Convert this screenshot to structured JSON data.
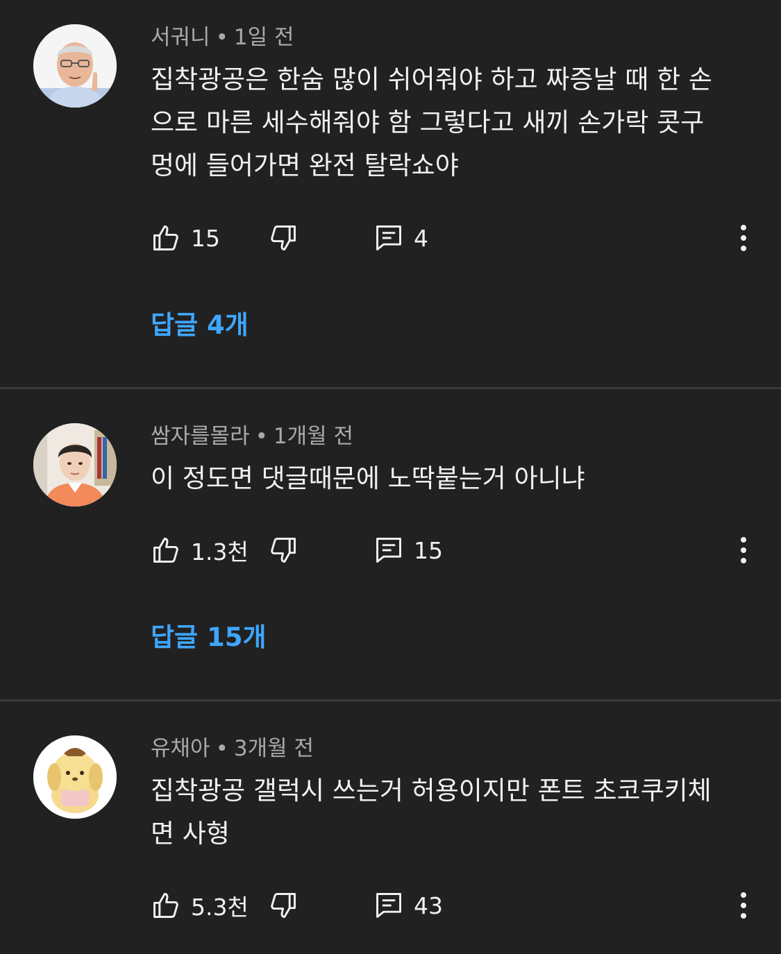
{
  "comments": [
    {
      "author": "서궈니",
      "time": "1일 전",
      "separator": "•",
      "lines": [
        "집착광공은 한숨 많이 쉬어줘야 하고 짜증날 때 한 손",
        "으로 마른 세수해줘야 함 그렇다고 새끼 손가락 콧구",
        "멍에 들어가면 완전 탈락쇼야"
      ],
      "likes": "15",
      "reply_count": "4",
      "replies_label": "답글 4개"
    },
    {
      "author": "쌈자를몰라",
      "time": "1개월 전",
      "separator": "•",
      "lines": [
        "이 정도면 댓글때문에 노딱붙는거 아니냐"
      ],
      "likes": "1.3천",
      "reply_count": "15",
      "replies_label": "답글 15개"
    },
    {
      "author": "유채아",
      "time": "3개월 전",
      "separator": "•",
      "lines": [
        "집착광공 갤럭시 쓰는거 허용이지만 폰트 초코쿠키체",
        "면 사형"
      ],
      "likes": "5.3천",
      "reply_count": "43"
    }
  ],
  "icons": {
    "like": "thumbs-up-icon",
    "dislike": "thumbs-down-icon",
    "reply": "comment-icon",
    "more": "more-vert-icon"
  },
  "colors": {
    "background": "#212121",
    "text": "#f1f1f1",
    "meta": "#aaaaaa",
    "link": "#3ea6ff",
    "divider": "#3a3a3a"
  }
}
